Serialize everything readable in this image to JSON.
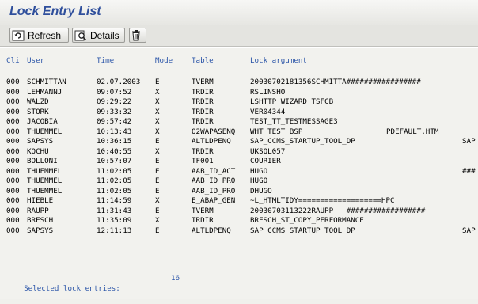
{
  "window": {
    "title": "Lock Entry List"
  },
  "toolbar": {
    "refresh_label": "Refresh",
    "details_label": "Details",
    "refresh_icon": "refresh-icon",
    "details_icon": "details-icon",
    "delete_icon": "trash-icon"
  },
  "table": {
    "columns": [
      "Cli",
      "User",
      "Time",
      "Mode",
      "Table",
      "Lock argument"
    ],
    "rows": [
      {
        "cli": "000",
        "user": "SCHMITTAN",
        "time": "02.07.2003",
        "mode": "E",
        "table": "TVERM",
        "arg": "20030702181356SCHMITTA#################",
        "extra": "",
        "extra_col": ""
      },
      {
        "cli": "000",
        "user": "LEHMANNJ",
        "time": "09:07:52",
        "mode": "X",
        "table": "TRDIR",
        "arg": "RSLINSHO",
        "extra": "",
        "extra_col": ""
      },
      {
        "cli": "000",
        "user": "WALZD",
        "time": "09:29:22",
        "mode": "X",
        "table": "TRDIR",
        "arg": "LSHTTP_WIZARD_TSFCB",
        "extra": "",
        "extra_col": ""
      },
      {
        "cli": "000",
        "user": "STORK",
        "time": "09:33:32",
        "mode": "X",
        "table": "TRDIR",
        "arg": "VER04344",
        "extra": "",
        "extra_col": ""
      },
      {
        "cli": "000",
        "user": "JACOBIA",
        "time": "09:57:42",
        "mode": "X",
        "table": "TRDIR",
        "arg": "TEST_TT_TESTMESSAGE3",
        "extra": "",
        "extra_col": ""
      },
      {
        "cli": "000",
        "user": "THUEMMEL",
        "time": "10:13:43",
        "mode": "X",
        "table": "O2WAPASENQ",
        "arg": "WHT_TEST_BSP",
        "extra": "PDEFAULT.HTM",
        "extra_col": "a"
      },
      {
        "cli": "000",
        "user": "SAPSYS",
        "time": "10:36:15",
        "mode": "E",
        "table": "ALTLDPENQ",
        "arg": "SAP_CCMS_STARTUP_TOOL_DP",
        "extra": "SAP",
        "extra_col": "b"
      },
      {
        "cli": "000",
        "user": "KOCHU",
        "time": "10:40:55",
        "mode": "X",
        "table": "TRDIR",
        "arg": "UKSQL057",
        "extra": "",
        "extra_col": ""
      },
      {
        "cli": "000",
        "user": "BOLLONI",
        "time": "10:57:07",
        "mode": "E",
        "table": "TF001",
        "arg": "COURIER",
        "extra": "",
        "extra_col": ""
      },
      {
        "cli": "000",
        "user": "THUEMMEL",
        "time": "11:02:05",
        "mode": "E",
        "table": "AAB_ID_ACT",
        "arg": "HUGO",
        "extra": "###",
        "extra_col": "c"
      },
      {
        "cli": "000",
        "user": "THUEMMEL",
        "time": "11:02:05",
        "mode": "E",
        "table": "AAB_ID_PRO",
        "arg": "HUGO",
        "extra": "",
        "extra_col": ""
      },
      {
        "cli": "000",
        "user": "THUEMMEL",
        "time": "11:02:05",
        "mode": "E",
        "table": "AAB_ID_PRO",
        "arg": "DHUGO",
        "extra": "",
        "extra_col": ""
      },
      {
        "cli": "000",
        "user": "HIEBLE",
        "time": "11:14:59",
        "mode": "X",
        "table": "E_ABAP_GEN",
        "arg": "~L_HTMLTIDY===================HPC",
        "extra": "",
        "extra_col": ""
      },
      {
        "cli": "000",
        "user": "RAUPP",
        "time": "11:31:43",
        "mode": "E",
        "table": "TVERM",
        "arg": "20030703113222RAUPP   ##################",
        "extra": "",
        "extra_col": ""
      },
      {
        "cli": "000",
        "user": "BRESCH",
        "time": "11:35:09",
        "mode": "X",
        "table": "TRDIR",
        "arg": "BRESCH_ST_COPY_PERFORMANCE",
        "extra": "",
        "extra_col": ""
      },
      {
        "cli": "000",
        "user": "SAPSYS",
        "time": "12:11:13",
        "mode": "E",
        "table": "ALTLDPENQ",
        "arg": "SAP_CCMS_STARTUP_TOOL_DP",
        "extra": "SAP",
        "extra_col": "b"
      }
    ]
  },
  "summary": {
    "label": "Selected lock entries:",
    "count": "16"
  },
  "colors": {
    "title": "#2f4f9c",
    "header_text": "#2b55a8",
    "background": "#f2f2ee"
  }
}
